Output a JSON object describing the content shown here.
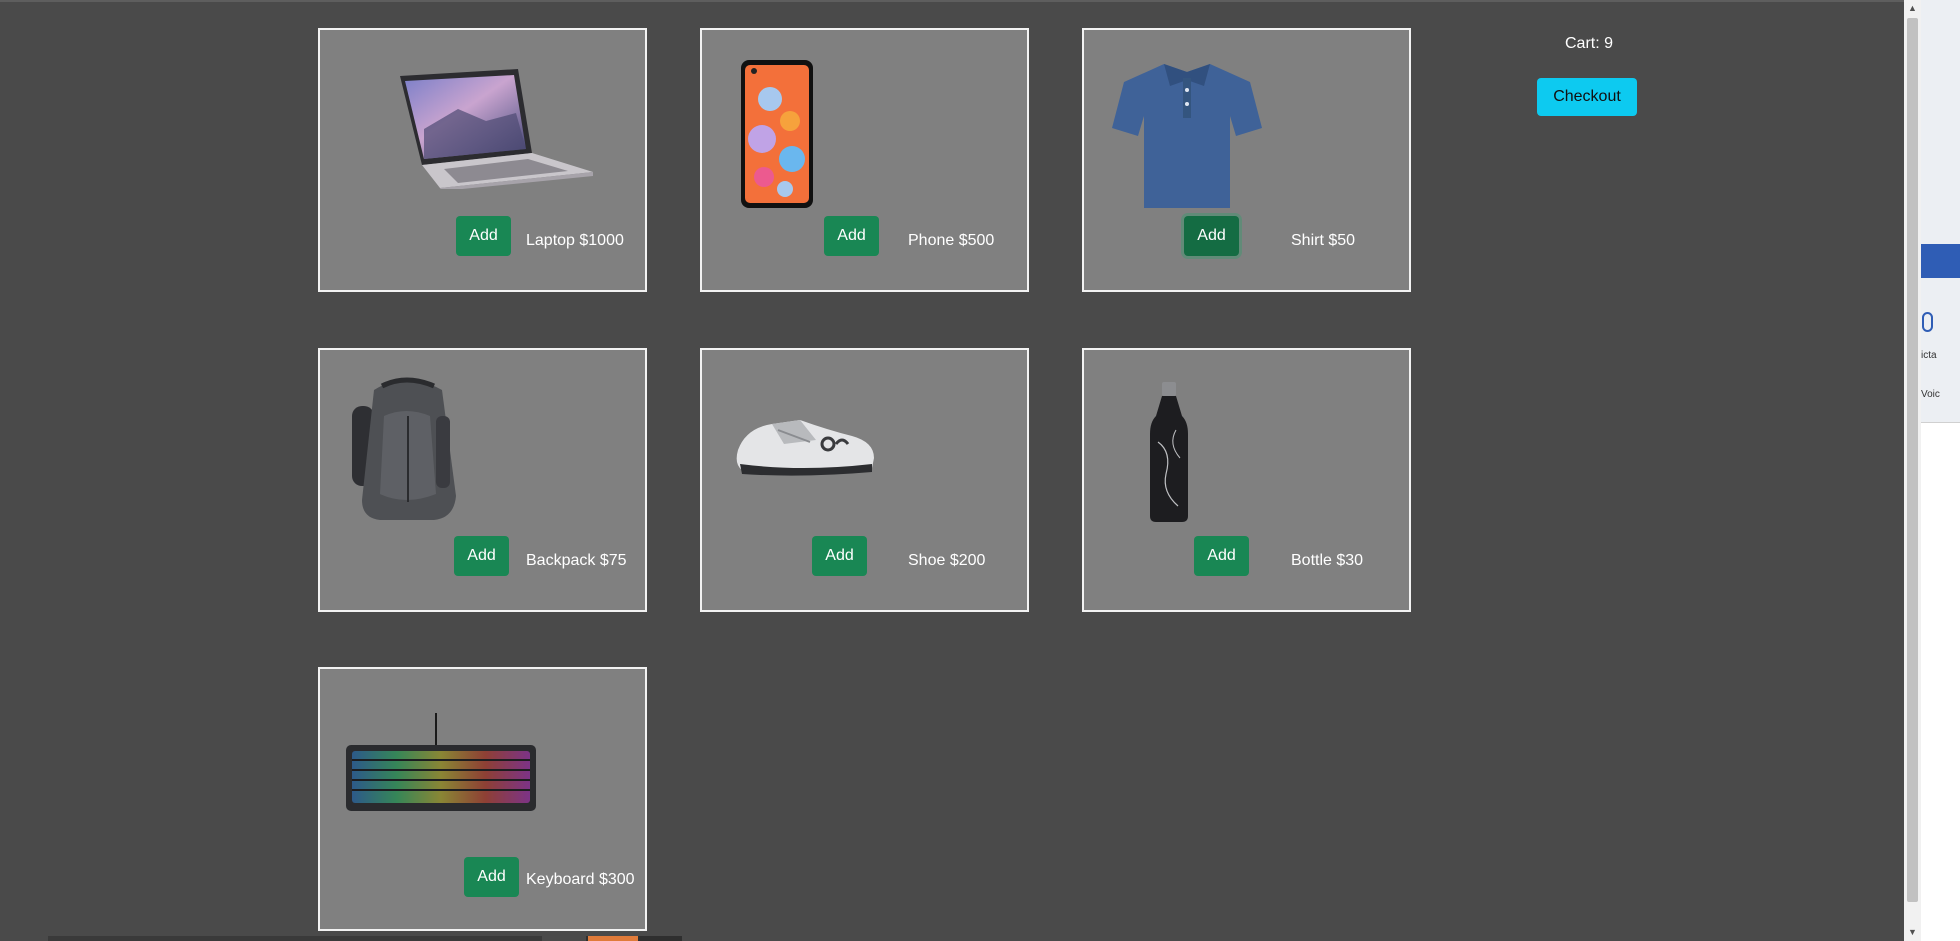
{
  "cart": {
    "label": "Cart: 9"
  },
  "checkout": {
    "label": "Checkout"
  },
  "products": [
    {
      "add_label": "Add",
      "label": "Laptop $1000"
    },
    {
      "add_label": "Add",
      "label": "Phone $500"
    },
    {
      "add_label": "Add",
      "label": "Shirt $50"
    },
    {
      "add_label": "Add",
      "label": "Backpack $75"
    },
    {
      "add_label": "Add",
      "label": "Shoe $200"
    },
    {
      "add_label": "Add",
      "label": "Bottle $30"
    },
    {
      "add_label": "Add",
      "label": "Keyboard $300"
    }
  ],
  "side_panel": {
    "text_1": "icta",
    "text_2": "Voic"
  },
  "colors": {
    "background": "#4a4a4a",
    "card": "#808080",
    "add_button": "#198754",
    "checkout_button": "#0dcaf0"
  }
}
